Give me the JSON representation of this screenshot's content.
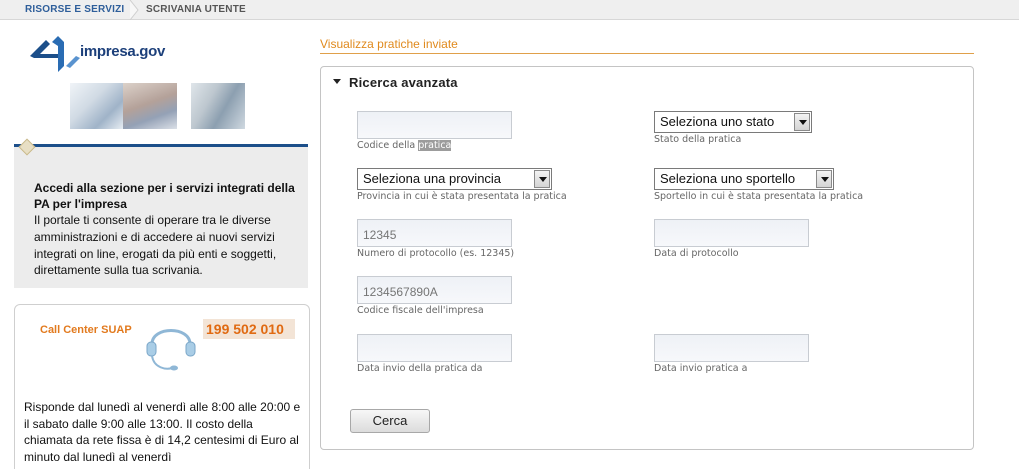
{
  "breadcrumb": {
    "items": [
      "RISORSE E SERVIZI",
      "SCRIVANIA UTENTE"
    ]
  },
  "logo": {
    "text": "impresa",
    "suffix": ".gov"
  },
  "info": {
    "title": "Accedi alla sezione per i servizi integrati della PA per l'impresa",
    "body": "Il portale ti consente di operare tra le diverse amministrazioni e di accedere ai nuovi servizi integrati on line, erogati da più enti e soggetti, direttamente sulla tua scrivania."
  },
  "callcenter": {
    "label": "Call Center SUAP",
    "number": "199 502 010",
    "body": "Risponde dal lunedì al venerdì alle 8:00 alle 20:00 e il sabato dalle 9:00 alle 13:00. Il costo della chiamata da rete fissa è di 14,2 centesimi di Euro al minuto dal lunedì al venerdì"
  },
  "section": {
    "title": "Visualizza pratiche inviate"
  },
  "panel": {
    "title": "Ricerca avanzata"
  },
  "form": {
    "codice_pratica": {
      "value": "",
      "label_pre": "Codice della ",
      "label_hl": "pratica"
    },
    "stato": {
      "selected": "Seleziona uno stato",
      "label": "Stato della pratica"
    },
    "provincia": {
      "selected": "Seleziona una provincia",
      "label": "Provincia in cui è stata presentata la pratica"
    },
    "sportello": {
      "selected": "Seleziona uno sportello",
      "label": "Sportello in cui è stata presentata la pratica"
    },
    "protocollo": {
      "placeholder": "12345",
      "label": "Numero di protocollo (es. 12345)"
    },
    "data_protocollo": {
      "value": "",
      "label": "Data di protocollo"
    },
    "codice_fiscale": {
      "placeholder": "1234567890A",
      "label": "Codice fiscale dell'impresa"
    },
    "data_da": {
      "value": "",
      "label": "Data invio della pratica da"
    },
    "data_a": {
      "value": "",
      "label": "Data invio pratica a"
    },
    "submit": "Cerca"
  },
  "colors": {
    "accent": "#e08a1e",
    "brand": "#1c4f8a",
    "link": "#2e5e9a"
  }
}
